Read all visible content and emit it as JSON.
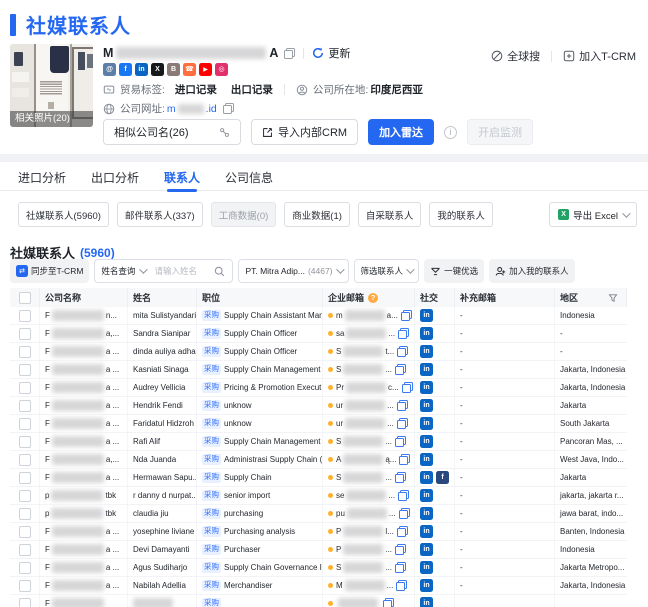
{
  "page_title": "社媒联系人",
  "header": {
    "photo_caption": "相关照片(20)",
    "company_prefix": "M",
    "company_suffix": "A",
    "refresh_label": "更新",
    "global_search": "全球搜",
    "join_tcrm": "加入T-CRM",
    "social_icons": [
      {
        "name": "blog-icon",
        "bg": "#5b7fa6",
        "glyph": "@"
      },
      {
        "name": "facebook-icon",
        "bg": "#1877f2",
        "glyph": "f"
      },
      {
        "name": "linkedin-icon",
        "bg": "#0a66c2",
        "glyph": "in"
      },
      {
        "name": "x-icon",
        "bg": "#17181a",
        "glyph": "X"
      },
      {
        "name": "forum-icon",
        "bg": "#8a7a76",
        "glyph": "B"
      },
      {
        "name": "phone-icon",
        "bg": "#ff6f3d",
        "glyph": "☎"
      },
      {
        "name": "youtube-icon",
        "bg": "#ff0000",
        "glyph": "▶"
      },
      {
        "name": "instagram-icon",
        "bg": "#e1306c",
        "glyph": "◎"
      }
    ],
    "trade_label": "贸易标签:",
    "trade_tags": [
      "进口记录",
      "出口记录"
    ],
    "location_label": "公司所在地:",
    "location_value": "印度尼西亚",
    "website_label": "公司网址:",
    "website_prefix": "m",
    "website_suffix": ".id",
    "similar_company": "相似公司名(26)",
    "import_crm": "导入内部CRM",
    "join_radar": "加入雷达",
    "start_monitor": "开启监测"
  },
  "tabs": [
    {
      "label": "进口分析",
      "active": false
    },
    {
      "label": "出口分析",
      "active": false
    },
    {
      "label": "联系人",
      "active": true
    },
    {
      "label": "公司信息",
      "active": false
    }
  ],
  "chips": [
    {
      "label": "社媒联系人(5960)",
      "disabled": false
    },
    {
      "label": "邮件联系人(337)",
      "disabled": false
    },
    {
      "label": "工商数据(0)",
      "disabled": true
    },
    {
      "label": "商业数据(1)",
      "disabled": false
    },
    {
      "label": "自采联系人",
      "disabled": false
    },
    {
      "label": "我的联系人",
      "disabled": false
    }
  ],
  "export_label": "导出 Excel",
  "section": {
    "title": "社媒联系人",
    "count": "(5960)"
  },
  "toolbar": {
    "sync_label": "同步至T-CRM",
    "name_query": "姓名查询",
    "search_placeholder": "请输入姓名",
    "company_filter": "PT. Mitra Adip...",
    "company_filter_count": "(4467)",
    "filter_contacts": "筛选联系人",
    "quick_select": "一键优选",
    "add_my_contacts": "加入我的联系人"
  },
  "table": {
    "columns": [
      "公司名称",
      "姓名",
      "职位",
      "企业邮箱",
      "社交",
      "补充邮箱",
      "地区"
    ],
    "purchase_tag": "采购",
    "rows": [
      {
        "company_prefix": "F",
        "company_suffix": "n...",
        "name": "mita Sulistyandari",
        "position": "Supply Chain Assistant Man...",
        "email_prefix": "m",
        "email_suffix": "a...",
        "social": [
          "in"
        ],
        "extra_email": "-",
        "region": "Indonesia"
      },
      {
        "company_prefix": "F",
        "company_suffix": "a,...",
        "name": "Sandra Sianipar",
        "position": "Supply Chain Officer",
        "email_prefix": "sa",
        "email_suffix": "...",
        "social": [
          "in"
        ],
        "extra_email": "-",
        "region": "-"
      },
      {
        "company_prefix": "F",
        "company_suffix": "a ...",
        "name": "dinda auliya adha",
        "position": "Supply Chain Officer",
        "email_prefix": "S",
        "email_suffix": "t...",
        "social": [
          "in"
        ],
        "extra_email": "-",
        "region": "-"
      },
      {
        "company_prefix": "F",
        "company_suffix": "a ...",
        "name": "Kasniati Sinaga",
        "position": "Supply Chain Management",
        "email_prefix": "S",
        "email_suffix": "...",
        "social": [
          "in"
        ],
        "extra_email": "-",
        "region": "Jakarta, Indonesia"
      },
      {
        "company_prefix": "F",
        "company_suffix": "a ...",
        "name": "Audrey Vellicia",
        "position": "Pricing & Promotion Execut...",
        "email_prefix": "Pr",
        "email_suffix": "c...",
        "social": [
          "in"
        ],
        "extra_email": "-",
        "region": "Jakarta, Indonesia"
      },
      {
        "company_prefix": "F",
        "company_suffix": "a ...",
        "name": "Hendrik Fendi",
        "position": "unknow",
        "email_prefix": "ur",
        "email_suffix": "...",
        "social": [
          "in"
        ],
        "extra_email": "-",
        "region": "Jakarta"
      },
      {
        "company_prefix": "F",
        "company_suffix": "a ...",
        "name": "Faridatul Hidzroh",
        "position": "unknow",
        "email_prefix": "ur",
        "email_suffix": "...",
        "social": [
          "in"
        ],
        "extra_email": "-",
        "region": "South Jakarta"
      },
      {
        "company_prefix": "F",
        "company_suffix": "a ...",
        "name": "Rafi Alif",
        "position": "Supply Chain Management ...",
        "email_prefix": "S",
        "email_suffix": "...",
        "social": [
          "in"
        ],
        "extra_email": "-",
        "region": "Pancoran Mas, ..."
      },
      {
        "company_prefix": "F",
        "company_suffix": "a,...",
        "name": "Nda Juanda",
        "position": "Administrasi Supply Chain (...",
        "email_prefix": "A",
        "email_suffix": "ą...",
        "social": [
          "in"
        ],
        "extra_email": "-",
        "region": "West Java, Indo..."
      },
      {
        "company_prefix": "F",
        "company_suffix": "a ...",
        "name": "Hermawan Sapu...",
        "position": "Supply Chain",
        "email_prefix": "S",
        "email_suffix": "...",
        "social": [
          "in",
          "fb"
        ],
        "extra_email": "-",
        "region": "Jakarta"
      },
      {
        "company_prefix": "p",
        "company_suffix": "tbk",
        "name": "r danny d nurpat...",
        "position": "senior import",
        "email_prefix": "se",
        "email_suffix": "...",
        "social": [
          "in"
        ],
        "extra_email": "-",
        "region": "jakarta, jakarta r..."
      },
      {
        "company_prefix": "p",
        "company_suffix": "tbk",
        "name": "claudia jiu",
        "position": "purchasing",
        "email_prefix": "pu",
        "email_suffix": "...",
        "social": [
          "in"
        ],
        "extra_email": "-",
        "region": "jawa barat, indo..."
      },
      {
        "company_prefix": "F",
        "company_suffix": "a ...",
        "name": "yosephine liviane",
        "position": "Purchasing analysis",
        "email_prefix": "P",
        "email_suffix": "l...",
        "social": [
          "in"
        ],
        "extra_email": "-",
        "region": "Banten, Indonesia"
      },
      {
        "company_prefix": "F",
        "company_suffix": "a ...",
        "name": "Devi Damayanti",
        "position": "Purchaser",
        "email_prefix": "P",
        "email_suffix": "...",
        "social": [
          "in"
        ],
        "extra_email": "-",
        "region": "Indonesia"
      },
      {
        "company_prefix": "F",
        "company_suffix": "a ...",
        "name": "Agus Sudiharjo",
        "position": "Supply Chain Governance In...",
        "email_prefix": "S",
        "email_suffix": "...",
        "social": [
          "in"
        ],
        "extra_email": "-",
        "region": "Jakarta Metropo..."
      },
      {
        "company_prefix": "F",
        "company_suffix": "a ...",
        "name": "Nabilah Adellia",
        "position": "Merchandiser",
        "email_prefix": "M",
        "email_suffix": "...",
        "social": [
          "in"
        ],
        "extra_email": "-",
        "region": "Jakarta, Indonesia"
      },
      {
        "company_prefix": "F",
        "company_suffix": "",
        "name": "",
        "position": "",
        "email_prefix": "",
        "email_suffix": "",
        "social": [
          "in"
        ],
        "extra_email": "",
        "region": "",
        "partial": true
      }
    ]
  }
}
